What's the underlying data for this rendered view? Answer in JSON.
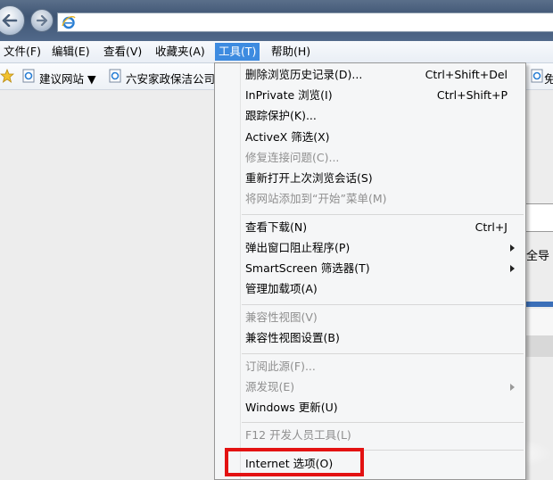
{
  "menubar": {
    "items": [
      {
        "label": "文件(F)"
      },
      {
        "label": "编辑(E)"
      },
      {
        "label": "查看(V)"
      },
      {
        "label": "收藏夹(A)"
      },
      {
        "label": "工具(T)"
      },
      {
        "label": "帮助(H)"
      }
    ]
  },
  "favorites": {
    "items": [
      {
        "label": "建议网站 ▼"
      },
      {
        "label": "六安家政保洁公司"
      },
      {
        "label": "免"
      }
    ]
  },
  "page": {
    "partial_text": "全导"
  },
  "tools_menu": {
    "items": [
      {
        "label": "删除浏览历史记录(D)...",
        "shortcut": "Ctrl+Shift+Del"
      },
      {
        "label": "InPrivate 浏览(I)",
        "shortcut": "Ctrl+Shift+P"
      },
      {
        "label": "跟踪保护(K)..."
      },
      {
        "label": "ActiveX 筛选(X)"
      },
      {
        "label": "修复连接问题(C)..."
      },
      {
        "label": "重新打开上次浏览会话(S)"
      },
      {
        "label": "将网站添加到“开始”菜单(M)"
      },
      {
        "label": "查看下载(N)",
        "shortcut": "Ctrl+J"
      },
      {
        "label": "弹出窗口阻止程序(P)"
      },
      {
        "label": "SmartScreen 筛选器(T)"
      },
      {
        "label": "管理加载项(A)"
      },
      {
        "label": "兼容性视图(V)"
      },
      {
        "label": "兼容性视图设置(B)"
      },
      {
        "label": "订阅此源(F)..."
      },
      {
        "label": "源发现(E)"
      },
      {
        "label": "Windows 更新(U)"
      },
      {
        "label": "F12 开发人员工具(L)"
      },
      {
        "label": "Internet 选项(O)"
      }
    ]
  },
  "colors": {
    "highlight_box": "#e31212",
    "menu_active": "#3d8be0"
  }
}
